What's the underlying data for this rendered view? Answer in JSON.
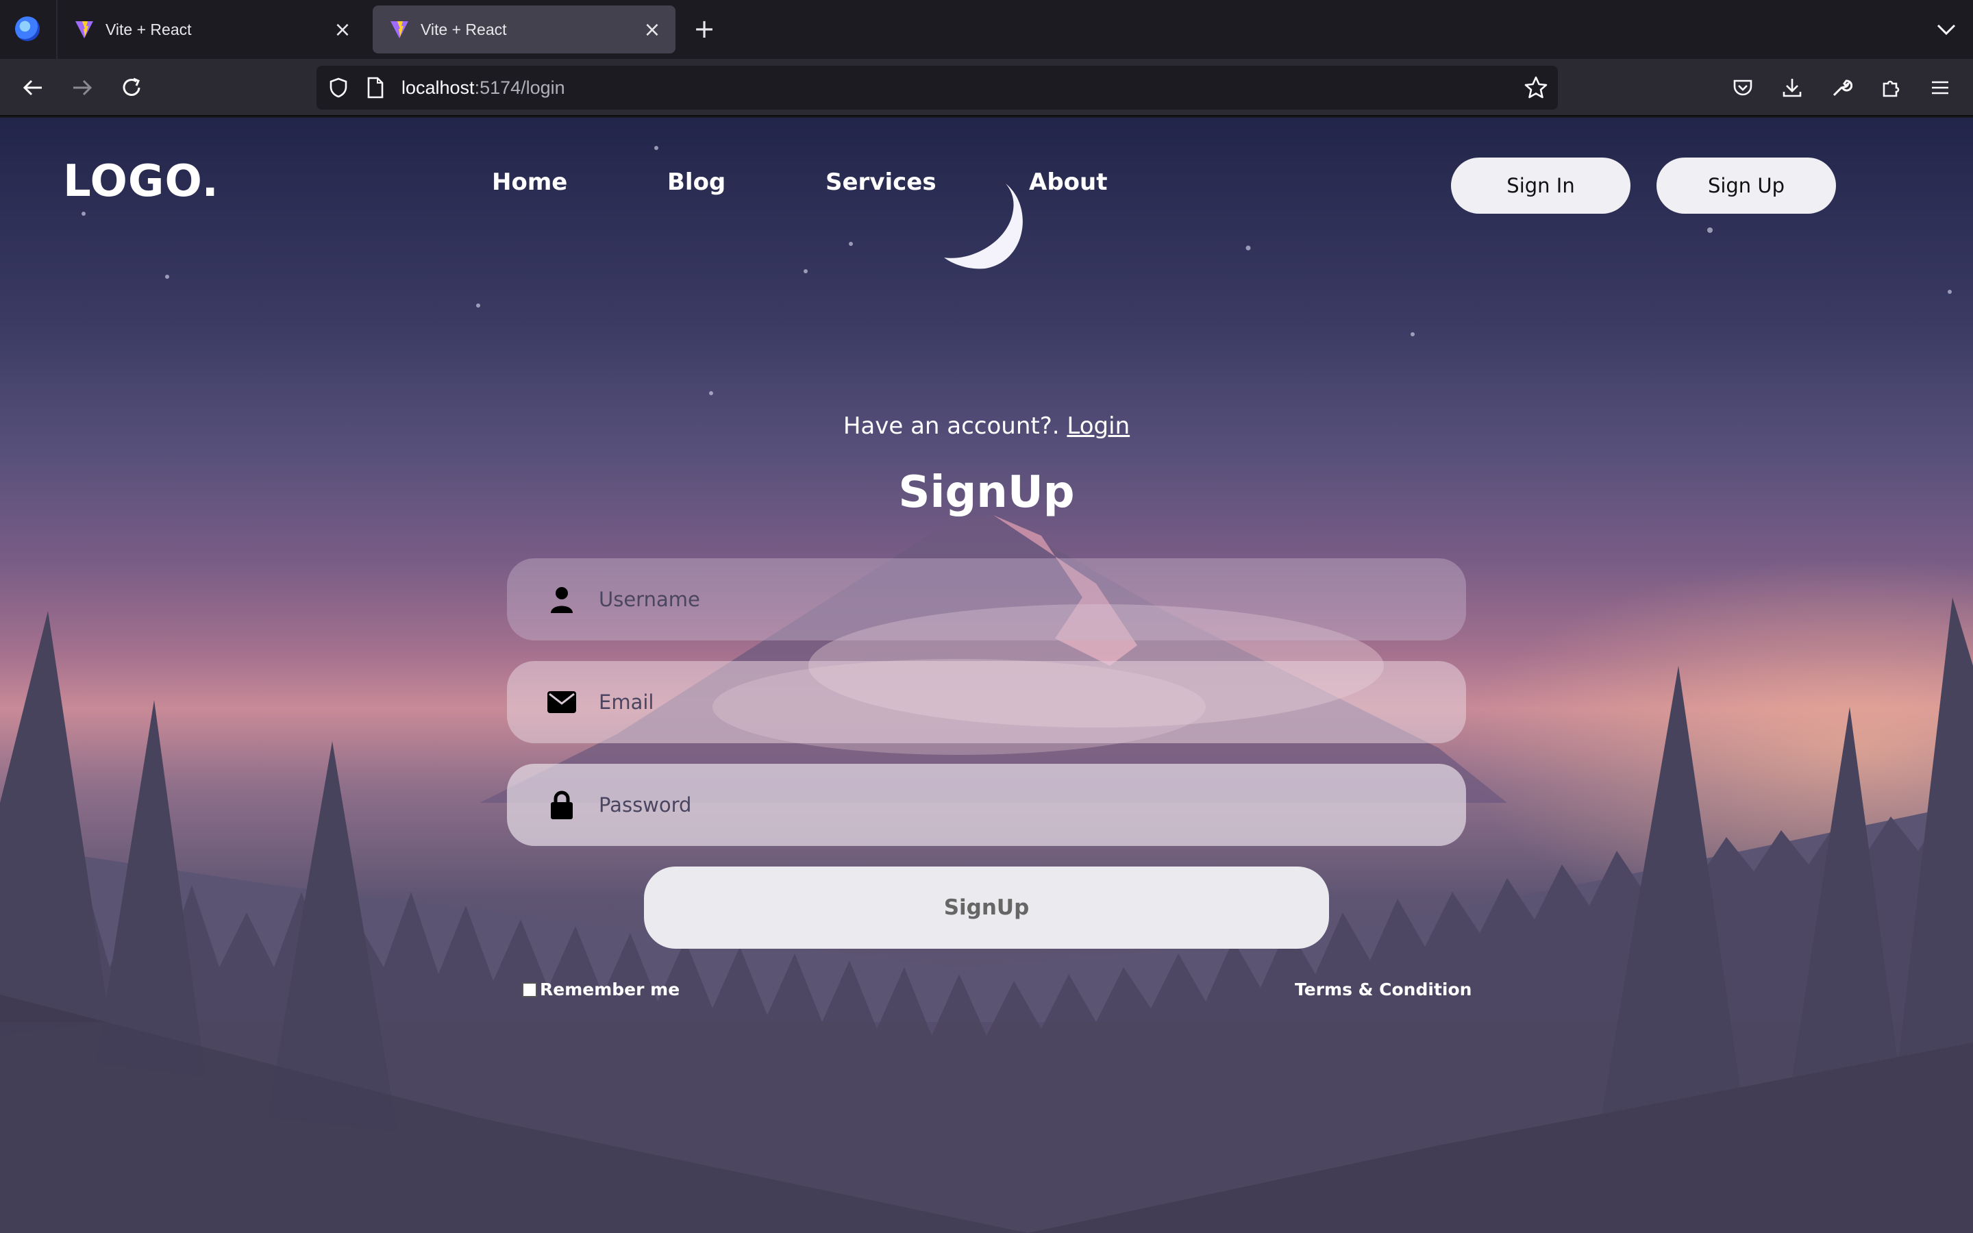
{
  "browser": {
    "tabs": [
      {
        "title": "Vite + React",
        "active": false
      },
      {
        "title": "Vite + React",
        "active": true
      }
    ],
    "url_host": "localhost",
    "url_rest": ":5174/login"
  },
  "header": {
    "logo": "LOGO.",
    "nav": [
      "Home",
      "Blog",
      "Services",
      "About"
    ],
    "sign_in": "Sign In",
    "sign_up": "Sign Up"
  },
  "form": {
    "have_account": "Have an account?. ",
    "login_link": "Login",
    "heading": "SignUp",
    "username_placeholder": "Username",
    "email_placeholder": "Email",
    "password_placeholder": "Password",
    "submit": "SignUp",
    "remember": "Remember me",
    "terms": "Terms & Condition"
  },
  "colors": {
    "chrome_dark": "#1c1b22",
    "chrome_toolbar": "#2b2a33",
    "button_bg": "#f0eff4"
  }
}
